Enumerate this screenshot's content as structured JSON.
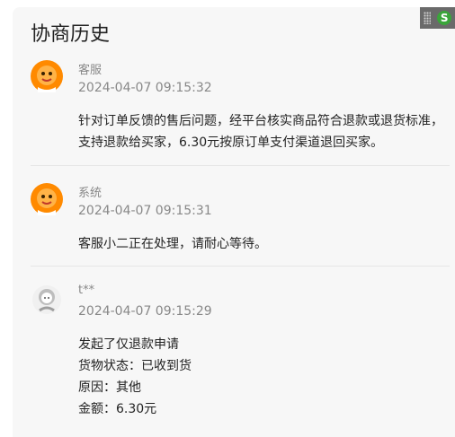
{
  "panel_title": "协商历史",
  "entries": [
    {
      "sender": "客服",
      "time": "2024-04-07 09:15:32",
      "avatar_icon": "orange-mascot-icon",
      "lines": [
        "针对订单反馈的售后问题，经平台核实商品符合退款或退货标准，",
        "支持退款给买家，6.30元按原订单支付渠道退回买家。"
      ]
    },
    {
      "sender": "系统",
      "time": "2024-04-07 09:15:31",
      "avatar_icon": "orange-mascot-icon",
      "lines": [
        "客服小二正在处理，请耐心等待。"
      ]
    },
    {
      "sender": "t**",
      "time": "2024-04-07 09:15:29",
      "avatar_icon": "gray-user-icon",
      "lines": [
        "发起了仅退款申请",
        "货物状态：已收到货",
        "原因：其他",
        "金额：6.30元"
      ]
    }
  ],
  "badge": {
    "logo_text": "S",
    "icon": "app-badge-icon"
  },
  "colors": {
    "mascot": "#ff8a00",
    "panel_bg": "#f7f7f7",
    "badge_bg": "#6a6a6a",
    "badge_logo": "#3aa53a"
  }
}
